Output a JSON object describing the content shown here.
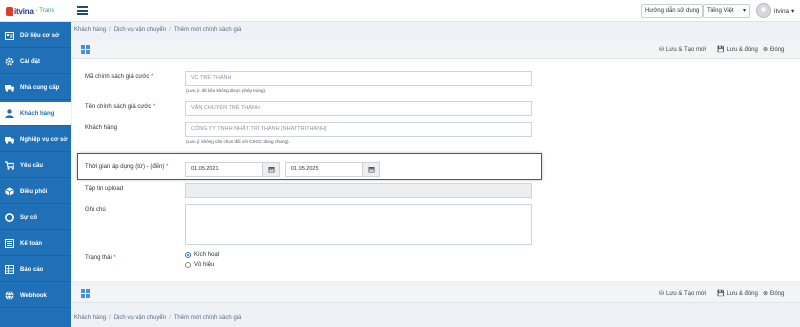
{
  "app": {
    "logo_text": "itvina",
    "logo_sub": "- Trans",
    "guide_btn": "Hướng dẫn sử dụng",
    "language": "Tiếng Việt",
    "username": "itvina"
  },
  "sidebar": {
    "items": [
      {
        "label": "Dữ liệu cơ sở",
        "icon": "id-card-icon"
      },
      {
        "label": "Cài đặt",
        "icon": "gear-icon"
      },
      {
        "label": "Nhà cung cấp",
        "icon": "truck-icon"
      },
      {
        "label": "Khách hàng",
        "icon": "user-icon"
      },
      {
        "label": "Nghiệp vụ cơ sở",
        "icon": "truck-icon"
      },
      {
        "label": "Yêu cầu",
        "icon": "cart-icon"
      },
      {
        "label": "Điều phối",
        "icon": "cube-icon"
      },
      {
        "label": "Sự cố",
        "icon": "lifebuoy-icon"
      },
      {
        "label": "Kế toán",
        "icon": "list-icon"
      },
      {
        "label": "Báo cáo",
        "icon": "table-icon"
      },
      {
        "label": "Webhook",
        "icon": "globe-icon"
      }
    ]
  },
  "breadcrumb": {
    "items": [
      "Khách hàng",
      "Dịch vụ vận chuyển",
      "Thêm mới chính sách giá"
    ],
    "sep": "/"
  },
  "toolbar": {
    "save_new": "Lưu & Tạo mới",
    "save_close": "Lưu & đóng",
    "close": "Đóng"
  },
  "form": {
    "code": {
      "label": "Mã chính sách giá cước",
      "value": "VC TRẺ THANH",
      "help": "(Lưu ý: dữ liệu không được phép trùng)."
    },
    "name": {
      "label": "Tên chính sách giá cước",
      "value": "VẬN CHUYỂN TRẺ THÀNH"
    },
    "customer": {
      "label": "Khách hàng",
      "value": "CÔNG TY TNHH NHẤT TRÍ THÀNH [NHATTRITHANH]",
      "help": "(Lưu ý: không cần chọn đối với CSGC dùng chung)."
    },
    "period": {
      "label": "Thời gian áp dụng (từ) - (đến)",
      "from": "01.05.2021",
      "to": "01.05.2025"
    },
    "upload": {
      "label": "Tập tin upload"
    },
    "note": {
      "label": "Ghi chú"
    },
    "status": {
      "label": "Trạng thái",
      "options": [
        "Kích hoạt",
        "Vô hiệu"
      ],
      "selected": "Kích hoạt"
    },
    "required_mark": "*"
  }
}
